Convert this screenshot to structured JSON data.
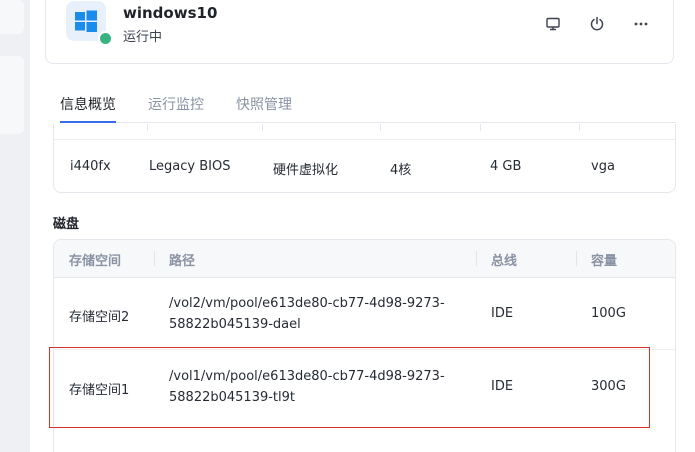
{
  "vm": {
    "name": "windows10",
    "status": "运行中",
    "status_color": "#36b37e",
    "icon": "windows-icon",
    "actions": [
      {
        "name": "console",
        "icon": "monitor-icon"
      },
      {
        "name": "power",
        "icon": "power-icon"
      },
      {
        "name": "more",
        "icon": "more-icon"
      }
    ]
  },
  "tabs": [
    {
      "label": "信息概览",
      "active": true
    },
    {
      "label": "运行监控",
      "active": false
    },
    {
      "label": "快照管理",
      "active": false
    }
  ],
  "info": {
    "chipset": "i440fx",
    "firmware": "Legacy BIOS",
    "virtualization": "硬件虚拟化",
    "cpu": "4核",
    "memory": "4 GB",
    "display": "vga"
  },
  "disks": {
    "title": "磁盘",
    "columns": [
      "存储空间",
      "路径",
      "总线",
      "容量"
    ],
    "rows": [
      {
        "storage": "存储空间2",
        "path_line1": "/vol2/vm/pool/e613de80-cb77-4d98-9273-",
        "path_line2": "58822b045139-dael",
        "bus": "IDE",
        "size": "100G"
      },
      {
        "storage": "存储空间1",
        "path_line1": "/vol1/vm/pool/e613de80-cb77-4d98-9273-",
        "path_line2": "58822b045139-tl9t",
        "bus": "IDE",
        "size": "300G"
      }
    ]
  },
  "colors": {
    "accent": "#3b6ce7",
    "highlight": "#d9302c"
  }
}
